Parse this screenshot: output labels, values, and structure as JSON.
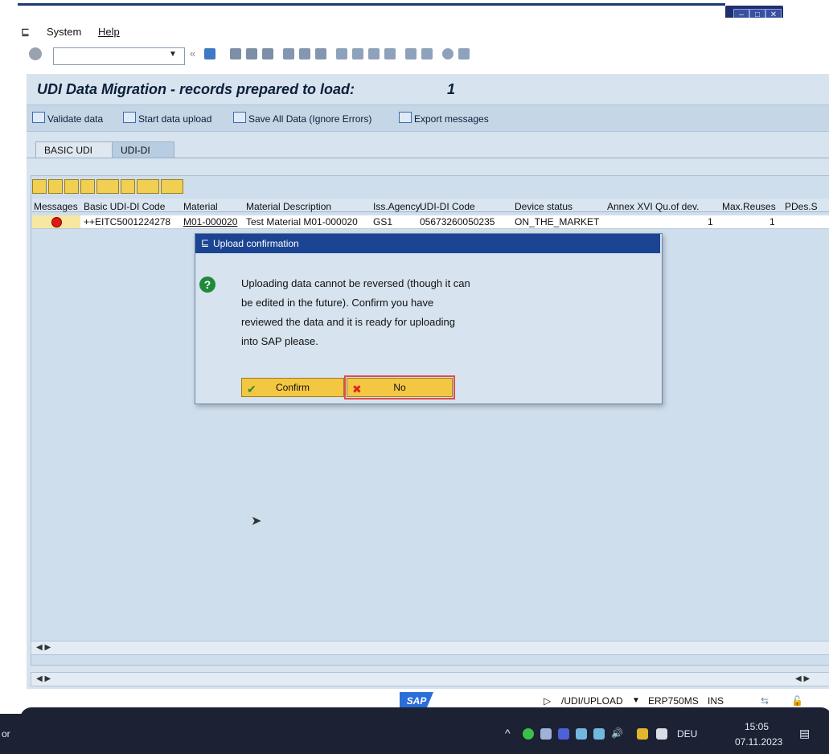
{
  "menu": {
    "system": "System",
    "help": "Help"
  },
  "toolbar": {
    "command_value": ""
  },
  "screen": {
    "title": "UDI Data Migration - records prepared to load:",
    "count": "1"
  },
  "app_toolbar": {
    "validate": "Validate data",
    "start_upload": "Start data upload",
    "save_all": "Save All Data (Ignore Errors)",
    "export": "Export messages"
  },
  "tabs": [
    {
      "label": "BASIC UDI"
    },
    {
      "label": "UDI-DI"
    }
  ],
  "table": {
    "columns": [
      "Messages",
      "Basic UDI-DI Code",
      "Material",
      "Material Description",
      "Iss.Agency",
      "UDI-DI Code",
      "Device status",
      "Annex XVI",
      "Qu.of dev.",
      "Max.Reuses",
      "PDes.S"
    ],
    "rows": [
      {
        "messages": "",
        "basic_udi": "++EITC5001224278",
        "material": "M01-000020",
        "description": "Test Material M01-000020",
        "agency": "GS1",
        "udi_di": "05673260050235",
        "status": "ON_THE_MARKET",
        "annex": "",
        "qty": "1",
        "reuses": "1",
        "pdes": ""
      }
    ]
  },
  "dialog": {
    "title": "Upload confirmation",
    "lines": [
      "Uploading data cannot be reversed (though it can",
      "be edited in the future). Confirm you have",
      "reviewed the data and it is ready for uploading",
      "into SAP please."
    ],
    "confirm": "Confirm",
    "no": "No"
  },
  "status": {
    "logo": "SAP",
    "transaction": "/UDI/UPLOAD",
    "system": "ERP750MS",
    "mode": "INS"
  },
  "taskbar": {
    "left_text": "or",
    "lang": "DEU",
    "time": "15:05",
    "date": "07.11.2023"
  },
  "colors": {
    "dialog_title": "#1b4493",
    "button": "#f4c742",
    "app_bg": "#d7e3ee"
  }
}
